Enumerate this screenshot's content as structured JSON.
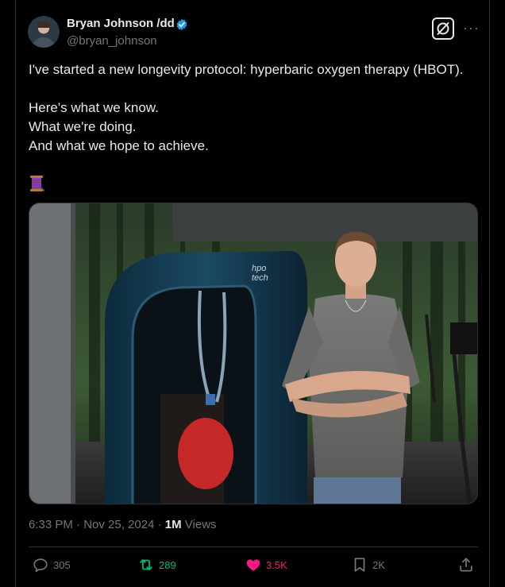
{
  "author": {
    "display_name": "Bryan Johnson /dd",
    "handle": "@bryan_johnson",
    "verified": true,
    "verified_color": "#1d9bf0"
  },
  "tweet": {
    "paragraphs": [
      "I've started a new longevity protocol: hyperbaric oxygen therapy (HBOT).",
      "Here's what we know.\nWhat we're doing.\nAnd what we hope to achieve."
    ],
    "emoji_icon": "thread-spool-icon",
    "image_icon": "hbot-chamber-photo"
  },
  "meta": {
    "time": "6:33 PM",
    "separator": " · ",
    "date": "Nov 25, 2024",
    "separator2": " · ",
    "views_count": "1M",
    "views_label": " Views"
  },
  "actions": {
    "replies": {
      "icon": "reply-icon",
      "count": "305"
    },
    "reposts": {
      "icon": "retweet-icon",
      "count": "289",
      "color": "#00ba7c"
    },
    "likes": {
      "icon": "heart-icon",
      "count": "3.5K",
      "color": "#f91880"
    },
    "bookmarks": {
      "icon": "bookmark-icon",
      "count": "2K"
    },
    "share": {
      "icon": "share-icon"
    }
  },
  "colors": {
    "background": "#000000",
    "text": "#e7e9ea",
    "secondary_text": "#71767b",
    "border": "#2f3336"
  }
}
